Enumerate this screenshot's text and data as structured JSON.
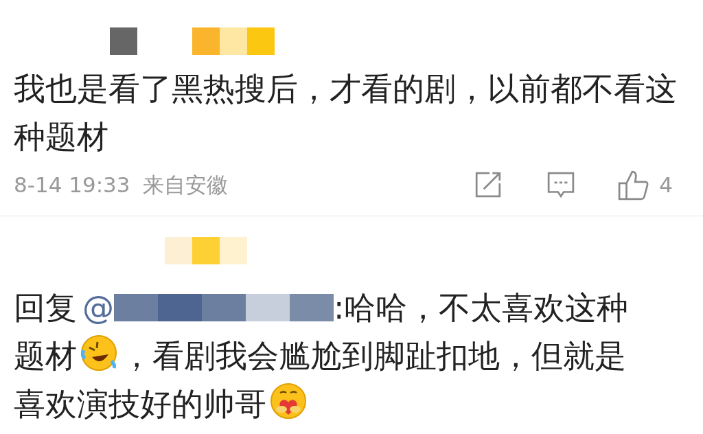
{
  "comments": [
    {
      "kind": "comment",
      "author_redaction": [
        {
          "color": "#666666"
        },
        {
          "color": "#fbb52c"
        },
        {
          "color": "#fde7a3"
        },
        {
          "color": "#fcc710"
        }
      ],
      "text": "我也是看了黑热搜后，才看的剧，以前都不看这种题材",
      "time": "8-14 19:33",
      "location": "来自安徽",
      "like_count": "4"
    },
    {
      "kind": "reply",
      "author_redaction": [
        {
          "color": "#fdefd3"
        },
        {
          "color": "#fdd033"
        },
        {
          "color": "#fef2cf"
        }
      ],
      "reply_prefix": "回复",
      "mention_at": "@",
      "mention_redaction": [
        {
          "color": "#6d7fa1"
        },
        {
          "color": "#4d6590"
        },
        {
          "color": "#6d7fa1"
        },
        {
          "color": "#c8cfdc"
        },
        {
          "color": "#7b8ca9"
        }
      ],
      "first_line_text": ":哈哈，不太喜欢这种",
      "lines": [
        [
          {
            "kind": "text",
            "text": "题材"
          },
          {
            "kind": "rofl_emoji"
          },
          {
            "kind": "text",
            "text": "，看剧我会尴尬到脚趾扣地，但就是"
          }
        ],
        [
          {
            "kind": "text",
            "text": "喜欢演技好的帅哥"
          },
          {
            "kind": "hug_emoji"
          }
        ]
      ]
    }
  ]
}
